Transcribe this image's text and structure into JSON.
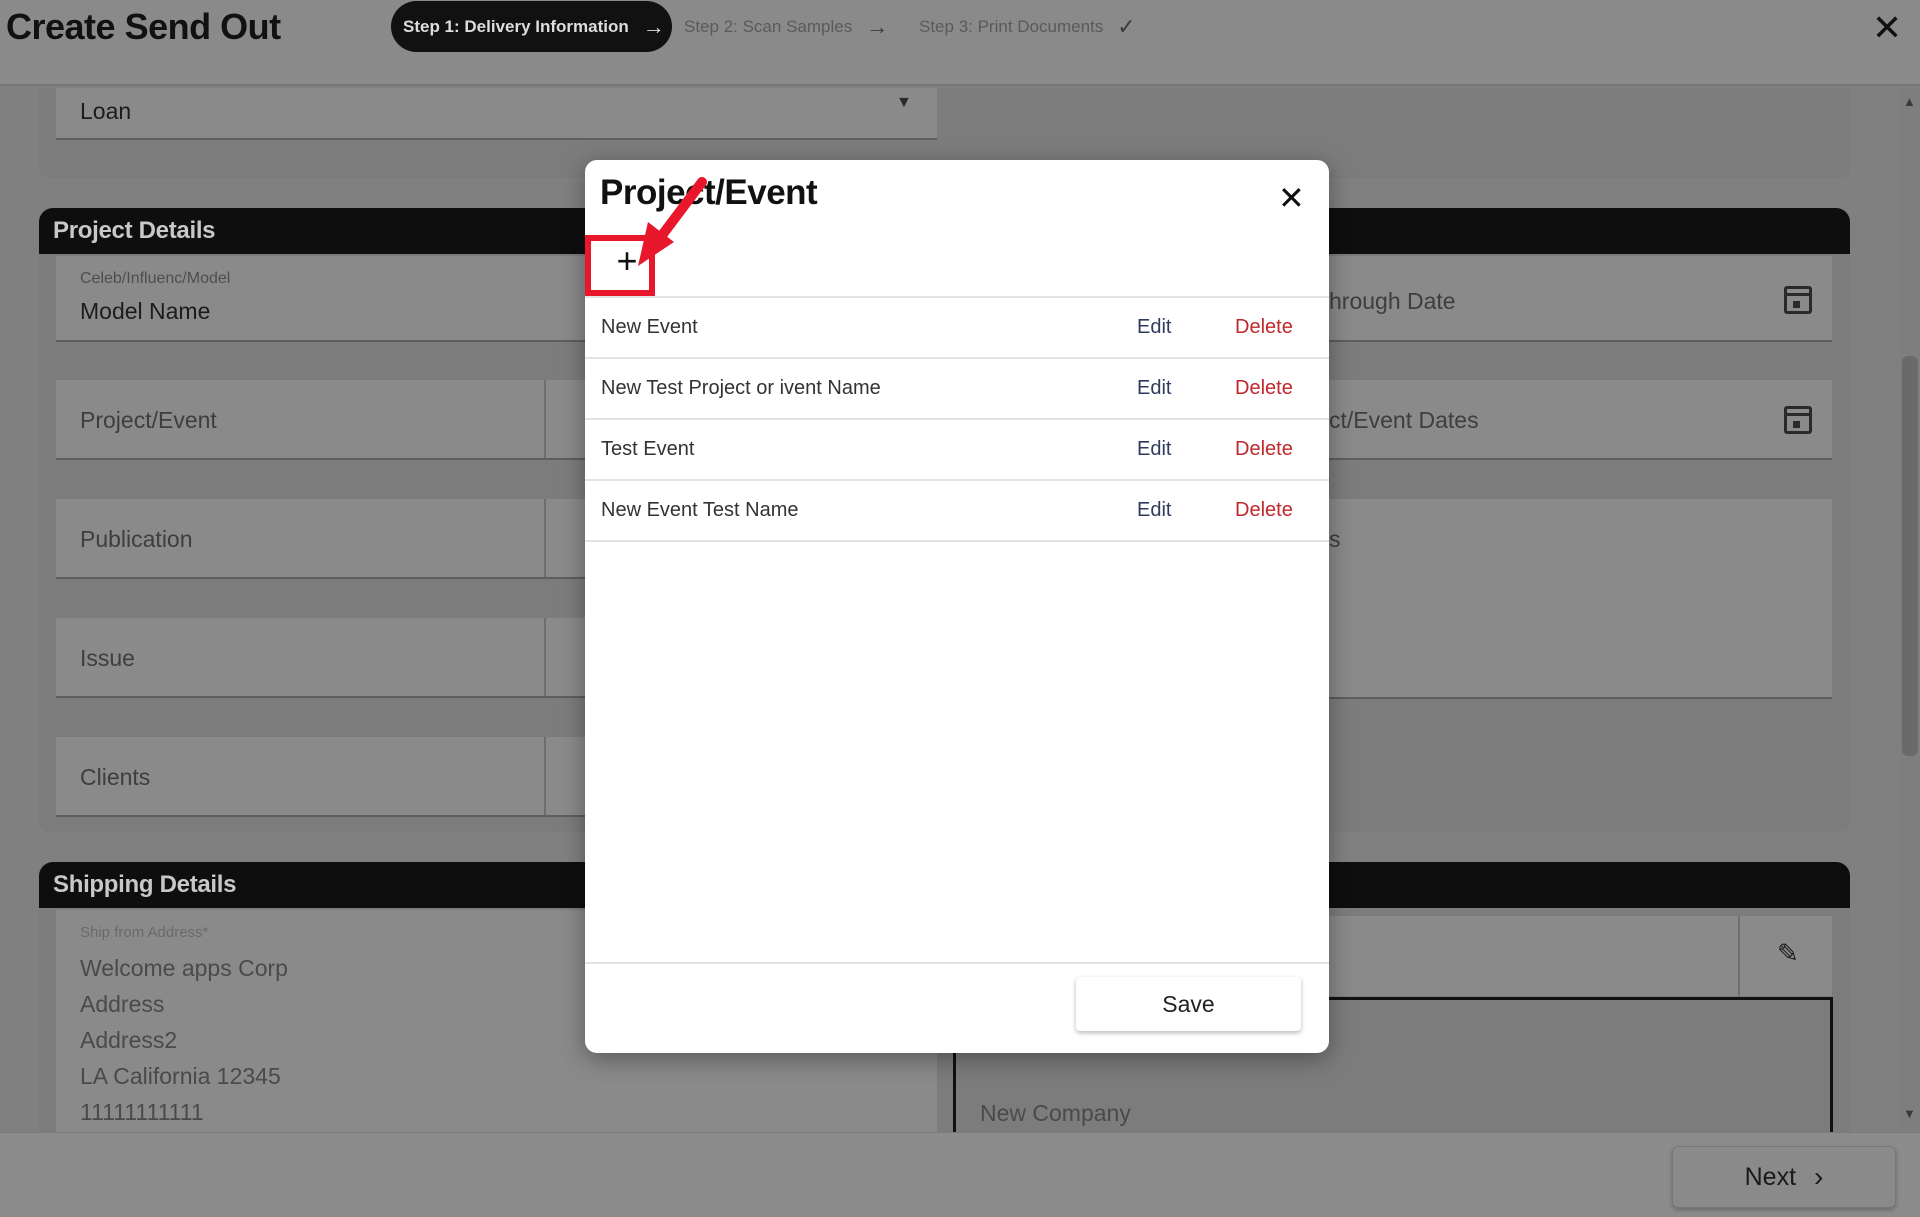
{
  "header": {
    "title": "Create Send Out",
    "steps": [
      {
        "label": "Step 1: Delivery Information",
        "icon": "arrow-right-icon"
      },
      {
        "label": "Step 2: Scan Samples",
        "icon": "arrow-right-icon"
      },
      {
        "label": "Step 3: Print Documents",
        "icon": "check-icon"
      }
    ],
    "close_icon": "close-icon"
  },
  "form": {
    "type_value": "Loan",
    "project_details": {
      "title": "Project Details",
      "celeb_label": "Celeb/Influenc/Model",
      "celeb_value": "Model Name",
      "project_event_placeholder": "Project/Event",
      "publication_placeholder": "Publication",
      "issue_placeholder": "Issue",
      "clients_placeholder": "Clients",
      "through_date_partial": "hrough Date",
      "event_dates_partial": "ct/Event Dates",
      "notes_partial": "s"
    },
    "shipping_details": {
      "title": "Shipping Details",
      "ship_from_label": "Ship from Address*",
      "address_lines": [
        "Welcome apps Corp",
        "Address",
        "Address2",
        "LA California 12345",
        "11111111111"
      ],
      "ship_to_company": "New Company"
    }
  },
  "modal": {
    "title": "Project/Event",
    "add_symbol": "+",
    "close_symbol": "✕",
    "rows": [
      {
        "name": "New Event",
        "edit": "Edit",
        "delete": "Delete"
      },
      {
        "name": "New Test Project or ivent Name",
        "edit": "Edit",
        "delete": "Delete"
      },
      {
        "name": "Test Event",
        "edit": "Edit",
        "delete": "Delete"
      },
      {
        "name": "New Event Test Name",
        "edit": "Edit",
        "delete": "Delete"
      }
    ],
    "save_label": "Save"
  },
  "footer": {
    "next_label": "Next"
  },
  "colors": {
    "highlight": "#e8172b",
    "delete_text": "#c0282d",
    "edit_text": "#2f3b5e",
    "section_bar": "#0e0e0e"
  }
}
